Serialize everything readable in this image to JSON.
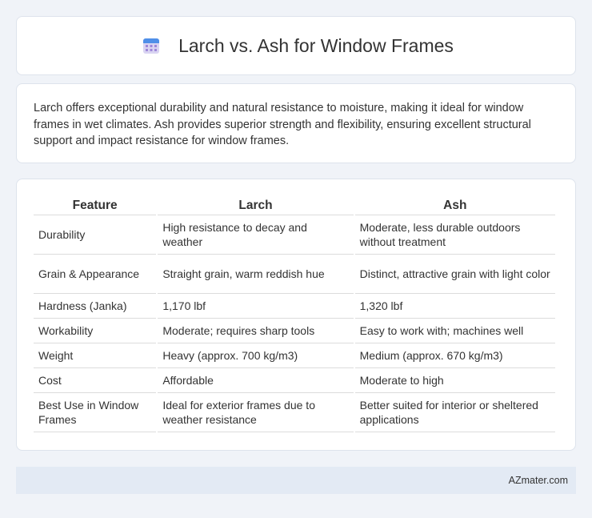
{
  "header": {
    "title": "Larch vs. Ash for Window Frames",
    "icon": "calendar-icon"
  },
  "intro": {
    "text": "Larch offers exceptional durability and natural resistance to moisture, making it ideal for window frames in wet climates. Ash provides superior strength and flexibility, ensuring excellent structural support and impact resistance for window frames."
  },
  "table": {
    "headers": [
      "Feature",
      "Larch",
      "Ash"
    ],
    "rows": [
      [
        "Durability",
        "High resistance to decay and weather",
        "Moderate, less durable outdoors without treatment"
      ],
      [
        "Grain & Appearance",
        "Straight grain, warm reddish hue",
        "Distinct, attractive grain with light color"
      ],
      [
        "Hardness (Janka)",
        "1,170 lbf",
        "1,320 lbf"
      ],
      [
        "Workability",
        "Moderate; requires sharp tools",
        "Easy to work with; machines well"
      ],
      [
        "Weight",
        "Heavy (approx. 700 kg/m3)",
        "Medium (approx. 670 kg/m3)"
      ],
      [
        "Cost",
        "Affordable",
        "Moderate to high"
      ],
      [
        "Best Use in Window Frames",
        "Ideal for exterior frames due to weather resistance",
        "Better suited for interior or sheltered applications"
      ]
    ]
  },
  "footer": {
    "text": "AZmater.com"
  },
  "colors": {
    "background": "#f0f3f8",
    "card": "#ffffff",
    "footer_bg": "#e3eaf4",
    "text": "#333333"
  }
}
